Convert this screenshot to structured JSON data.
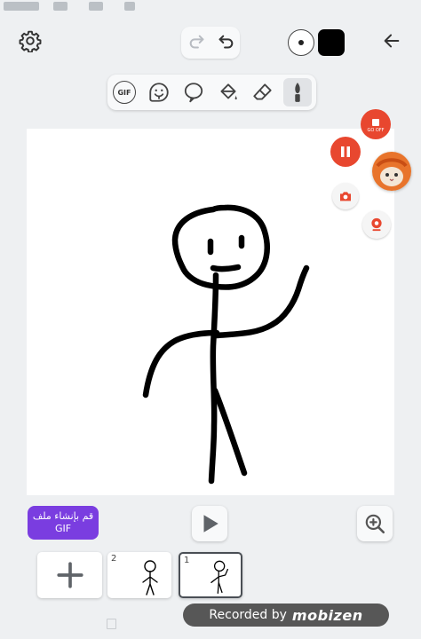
{
  "colors": {
    "accent": "#7a3de0",
    "record": "#e8472f",
    "canvas": "#ffffff",
    "background": "#eef0f2"
  },
  "toolbar": {
    "settings_icon": "gear-icon",
    "redo_icon": "redo-icon",
    "undo_icon": "undo-icon",
    "brush_size_icon": "brush-size-icon",
    "color_swatch": "#000000",
    "back_icon": "arrow-left-icon"
  },
  "tools": [
    {
      "name": "gif-sticker-tool",
      "label": "GIF"
    },
    {
      "name": "sticker-tool",
      "icon": "sticker-icon"
    },
    {
      "name": "balloon-tool",
      "icon": "speech-balloon-icon"
    },
    {
      "name": "fill-tool",
      "icon": "paint-bucket-icon"
    },
    {
      "name": "eraser-tool",
      "icon": "eraser-icon"
    },
    {
      "name": "brush-tool",
      "icon": "brush-icon",
      "selected": true
    }
  ],
  "recorder": {
    "stop_label": "GO OFF",
    "pause_icon": "pause-icon",
    "camera_icon": "camera-icon",
    "webcam_icon": "webcam-icon"
  },
  "actions": {
    "create_gif_line1": "قم بإنشاء ملف",
    "create_gif_line2": "GIF",
    "play_icon": "play-icon",
    "zoom_icon": "zoom-in-icon"
  },
  "frames": [
    {
      "number": "2"
    },
    {
      "number": "1",
      "selected": true
    }
  ],
  "watermark": {
    "text": "Recorded by",
    "brand": "mobizen"
  }
}
